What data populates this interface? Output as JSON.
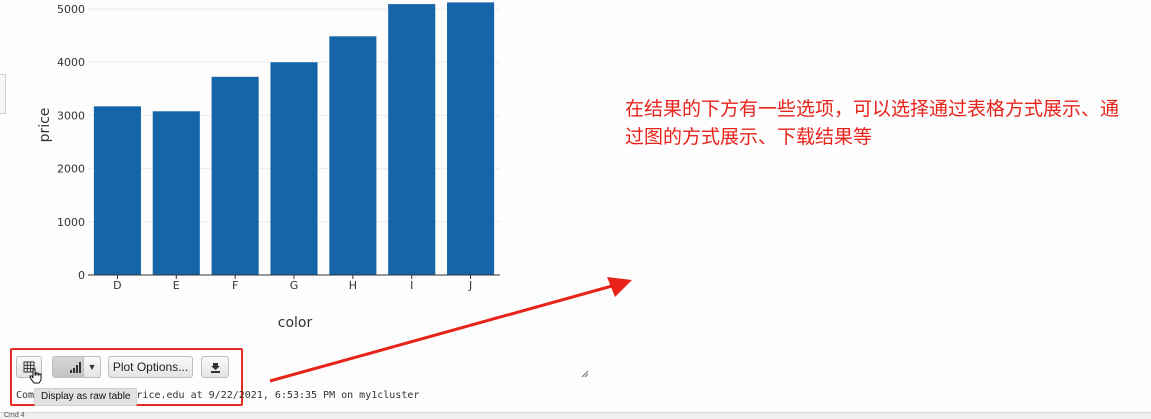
{
  "chart_data": {
    "type": "bar",
    "categories": [
      "D",
      "E",
      "F",
      "G",
      "H",
      "I",
      "J"
    ],
    "values": [
      3170,
      3077,
      3725,
      3999,
      4486,
      5092,
      5124
    ],
    "xlabel": "color",
    "ylabel": "price",
    "yticks": [
      0,
      1000,
      2000,
      3000,
      4000,
      5000
    ],
    "ylim": [
      0,
      5150
    ],
    "bar_color": "#1565a8",
    "grid": true
  },
  "annotation": {
    "text": "在结果的下方有一些选项，可以选择通过表格方式展示、通过图的方式展示、下载结果等",
    "color": "#e8231b"
  },
  "toolbar": {
    "table_icon": "table-icon",
    "chart_icon": "bar-chart-icon",
    "dropdown_icon": "chevron-down-icon",
    "plot_options_label": "Plot Options...",
    "download_icon": "download-icon"
  },
  "tooltip": {
    "text": "Display as raw table"
  },
  "footer": {
    "text": "Com                              onds -- by ly21@rice.edu at 9/22/2021, 6:53:35 PM on my1cluster"
  },
  "status": {
    "text": "Cmd 4"
  }
}
